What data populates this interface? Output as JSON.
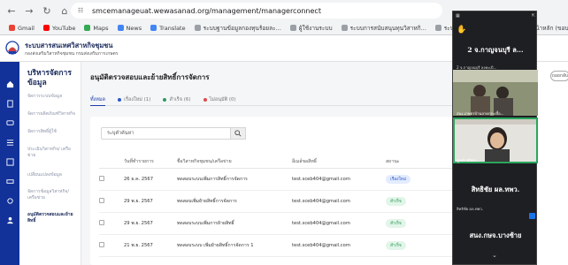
{
  "browser": {
    "url": "smcemanageuat.wewasanad.org/management/managerconnect",
    "bookmarks": [
      {
        "label": "Gmail",
        "color": "#ea4335"
      },
      {
        "label": "YouTube",
        "color": "#ff0000"
      },
      {
        "label": "Maps",
        "color": "#34a853"
      },
      {
        "label": "News",
        "color": "#4285f4"
      },
      {
        "label": "Translate",
        "color": "#4285f4"
      },
      {
        "label": "ระบบฐานข้อมูลกองทุนร้อยละ...",
        "color": "#9aa0a6"
      },
      {
        "label": "ผู้ใช้งานระบบ",
        "color": "#9aa0a6"
      },
      {
        "label": "ระบบการสนับสนุนทุนวิสาหกิ...",
        "color": "#9aa0a6"
      },
      {
        "label": "ระบบงานการบริหารสินทรั...",
        "color": "#9aa0a6"
      },
      {
        "label": "หน้าหลัก (ขอบ...",
        "color": "#9aa0a6"
      }
    ]
  },
  "header": {
    "title": "ระบบสารสนเทศวิสาหกิจชุมชน",
    "subtitle": "กองส่งเสริมวิสาหกิจชุมชน กรมส่งเสริมการเกษตร"
  },
  "sidemenu": {
    "title": "บริหารจัดการข้อมูล",
    "items": [
      {
        "label": "จัดการระบบข้อมูล",
        "active": false
      },
      {
        "label": "จัดการผลิตภัณฑ์วิสาหกิจ",
        "active": false
      },
      {
        "label": "จัดการสิทธิ์ผู้ใช้",
        "active": false
      },
      {
        "label": "ประเมินวิสาหกิจ/ เครือข่าย",
        "active": false
      },
      {
        "label": "เปลี่ยนแปลงข้อมูล",
        "active": false
      },
      {
        "label": "จัดการข้อมูลวิสาหกิจ/ เครือข่าย",
        "active": false
      },
      {
        "label": "อนุมัติตรวจสอบและย้ายสิทธิ์",
        "active": true
      }
    ]
  },
  "main": {
    "page_title": "อนุมัติตรวจสอบและย้ายสิทธิ์การจัดการ",
    "tabs": [
      {
        "label": "ทั้งหมด",
        "dot": "",
        "active": true
      },
      {
        "label": "เรื่องใหม่ (1)",
        "dot": "#2a58c9",
        "active": false
      },
      {
        "label": "สำเร็จ (6)",
        "dot": "#2d9a5a",
        "active": false
      },
      {
        "label": "ไม่อนุมัติ (0)",
        "dot": "#e04848",
        "active": false
      }
    ],
    "search_placeholder": "ระบุคำค้นหา",
    "columns": [
      "วันที่ทำรายการ",
      "ชื่อวิสาหกิจชุมชน/เครือข่าย",
      "อีเมล์ขอสิทธิ์",
      "สถานะ"
    ],
    "rows": [
      {
        "date": "26 ธ.ค. 2567",
        "name": "ทดสอบระบบเพิ่มการสิทธิ์การจัดการ",
        "email": "test.sceb404@gmail.com",
        "status": "เรื่องใหม่",
        "kind": "new"
      },
      {
        "date": "29 พ.ย. 2567",
        "name": "ทดสอบเพิ่มย้ายสิทธิ์การจัดการ",
        "email": "test.sceb404@gmail.com",
        "status": "สำเร็จ",
        "kind": "approved"
      },
      {
        "date": "29 พ.ย. 2567",
        "name": "ทดสอบระบบเพิ่มการย้ายสิทธิ์",
        "email": "test.sceb404@gmail.com",
        "status": "สำเร็จ",
        "kind": "approved"
      },
      {
        "date": "21 พ.ย. 2567",
        "name": "ทดสอบระบบ เพิ่มย้ายสิทธิ์การจัดการ 1",
        "email": "test.sceb404@gmail.com",
        "status": "สำเร็จ",
        "kind": "approved"
      }
    ]
  },
  "right": {
    "button": "ถอยกลับ"
  },
  "meeting": {
    "tiles": [
      {
        "name": "2 จ.กาญจนบุรี ล...",
        "label": "2 จ.กาญจนบุรี ลงทะเบี...",
        "type": "name"
      },
      {
        "name": "",
        "label": "สนง.เกษตรบ้านลาดกระเบื้อ...",
        "type": "video"
      },
      {
        "name": "",
        "label": "ศูนย์ฯ พิจิตร...",
        "type": "video"
      },
      {
        "name": "สิทธิชัย ผล.ทพว.",
        "label": "สิทธิชัย ผล.ทพว.",
        "type": "name"
      },
      {
        "name": "สนง.กษจ.บางซ้าย",
        "label": "",
        "type": "name"
      }
    ]
  }
}
